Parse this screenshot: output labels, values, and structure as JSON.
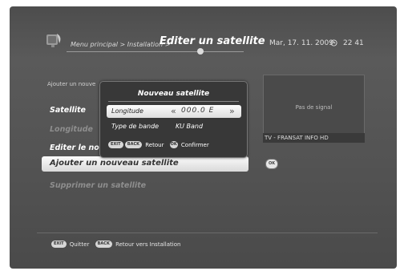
{
  "header": {
    "breadcrumb": "Menu principal > Installation >",
    "title": "Editer un satellite",
    "date": "Mar, 17. 11. 2009",
    "time": "22 41",
    "clock_icon": "clock-icon"
  },
  "menu": {
    "subheading": "Ajouter un nouve",
    "items": [
      {
        "label": "Satellite"
      },
      {
        "label": "Longitude"
      },
      {
        "label": "Editer le nom"
      },
      {
        "label": "Ajouter un nouveau satellite"
      },
      {
        "label": "Supprimer un satellite"
      }
    ],
    "ok_label": "OK"
  },
  "preview": {
    "status": "Pas de signal",
    "channel": "TV - FRANSAT INFO HD"
  },
  "dialog": {
    "title": "Nouveau satellite",
    "longitude_label": "Longitude",
    "longitude_value": "000.0 E",
    "band_label": "Type de bande",
    "band_value": "KU Band",
    "exit_key": "EXIT",
    "back_key": "BACK",
    "back_label": "Retour",
    "ok_key": "OK",
    "confirm_label": "Confirmer"
  },
  "footer": {
    "exit_key": "EXIT",
    "exit_label": "Quitter",
    "back_key": "BACK",
    "back_label": "Retour vers Installation"
  },
  "colors": {
    "background": "#525252",
    "highlight": "#f0f0f0",
    "dialog": "#383838"
  }
}
